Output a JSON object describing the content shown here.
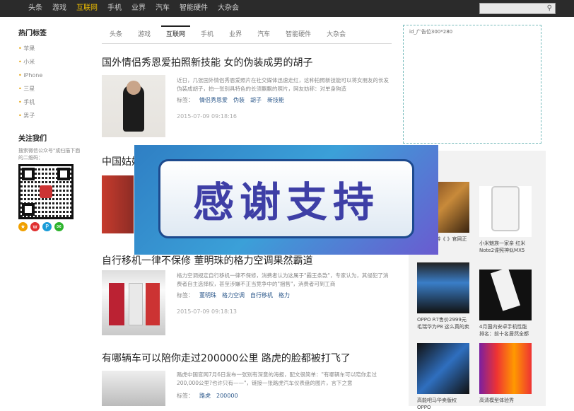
{
  "topnav": [
    "头条",
    "游戏",
    "互联网",
    "手机",
    "业界",
    "汽车",
    "智能硬件",
    "大杂会"
  ],
  "topnav_active": "互联网",
  "left": {
    "hot_tags_title": "热门标签",
    "tags": [
      "苹果",
      "小米",
      "iPhone",
      "三星",
      "手机",
      "男子"
    ],
    "follow_title": "关注我们",
    "follow_desc": "搜索微信公众号\"或扫描下面的二维码："
  },
  "tabs": [
    "头条",
    "游戏",
    "互联网",
    "手机",
    "业界",
    "汽车",
    "智能硬件",
    "大杂会"
  ],
  "tabs_active": "互联网",
  "articles": [
    {
      "title": "国外情侣秀恩爱拍照新技能 女的伪装成男的胡子",
      "summary": "近日，几张国外情侣秀恩爱照片在社交媒体迅速走红，这种拍照新技能可以将女朋友的长发伪装成胡子，拍一张别具特色的长须飘飘的照片，网友妨称：对单身狗造",
      "tags_label": "标签：",
      "tags": [
        "情侣秀恩爱",
        "伪装",
        "胡子",
        "新技能"
      ],
      "date": "2015-07-09 09:18:16"
    },
    {
      "title": "中国姑娘",
      "summary": "",
      "tags_label": "",
      "tags": [],
      "date": ""
    },
    {
      "title": "自行移机一律不保修 董明珠的格力空调果然霸道",
      "summary": "格力空调规定自行移机一律不保修，消费者认为这属于\"霸王条款\"，专家认为，其侵犯了消费者自主选择权，甚至涉嫌不正当竞争中的\"捆售\"，消费者可到工商",
      "tags_label": "标签：",
      "tags": [
        "董明珠",
        "格力空调",
        "自行移机",
        "格力"
      ],
      "date": "2015-07-09 09:18:13"
    },
    {
      "title": "有哪辆车可以陪你走过200000公里 路虎的脸都被打飞了",
      "summary": "路虎中国官网7月6日发布一张别有深意的海报，配文很简单：\"有哪辆车可以陪你走过200,000公里?也许只有——\"，链接一张路虎汽车仪表盘的图片，言下之意",
      "tags_label": "标签：",
      "tags": [
        "路虎",
        "200000"
      ],
      "date": ""
    }
  ],
  "ad_label": "id_广告位300*280",
  "right_cards": [
    {
      "caption": "ZRPG手游《 》官网正"
    },
    {
      "caption": "小米魅族一家亲 红米Note2谍照神似MX5"
    },
    {
      "caption": "OPPO R7售价2999元毛瑞华为P8 这么真的卖"
    },
    {
      "caption": "4月国内安卓手机性能排名：前十名居然全都"
    },
    {
      "caption": "高能吧马华卖版权OPPO"
    },
    {
      "caption": "高清模型体验秀 "
    }
  ],
  "overlay_text": "感谢支持",
  "colors": {
    "topbar": "#2b2b2b",
    "accent": "#f0c000",
    "tag_link": "#2e5a8c",
    "overlay_text": "#3e3fa6"
  }
}
